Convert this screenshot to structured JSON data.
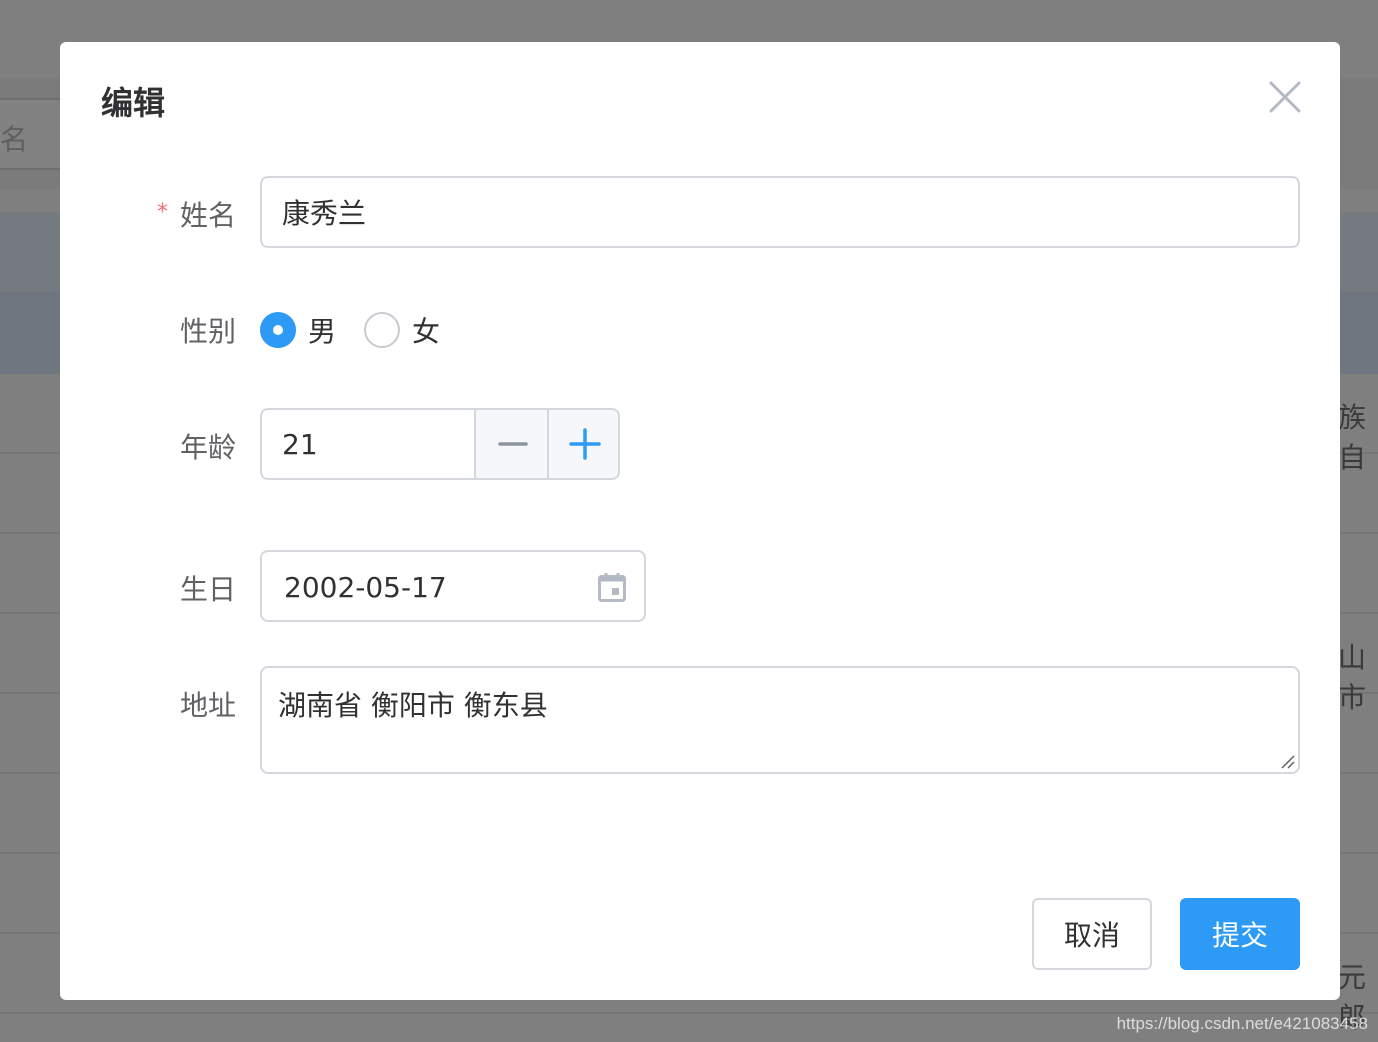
{
  "background": {
    "search_text": "名",
    "right_fragments": [
      "族自",
      "山市",
      "元郎"
    ],
    "watermark": "https://blog.csdn.net/e421083458"
  },
  "dialog": {
    "title": "编辑",
    "close_icon": "close-icon",
    "fields": {
      "name": {
        "label": "姓名",
        "required_mark": "*",
        "value": "康秀兰"
      },
      "gender": {
        "label": "性别",
        "options": [
          {
            "label": "男",
            "checked": true
          },
          {
            "label": "女",
            "checked": false
          }
        ]
      },
      "age": {
        "label": "年龄",
        "value": "21",
        "decrement_icon": "minus-icon",
        "increment_icon": "plus-icon"
      },
      "birthday": {
        "label": "生日",
        "value": "2002-05-17",
        "icon": "calendar-icon"
      },
      "address": {
        "label": "地址",
        "value": "湖南省 衡阳市 衡东县"
      }
    },
    "footer": {
      "cancel_label": "取消",
      "submit_label": "提交"
    }
  },
  "colors": {
    "primary": "#2d9af5",
    "required": "#f56c6c",
    "border": "#d4d7de",
    "text": "#303133",
    "label": "#606266",
    "overlay": "#808080"
  }
}
